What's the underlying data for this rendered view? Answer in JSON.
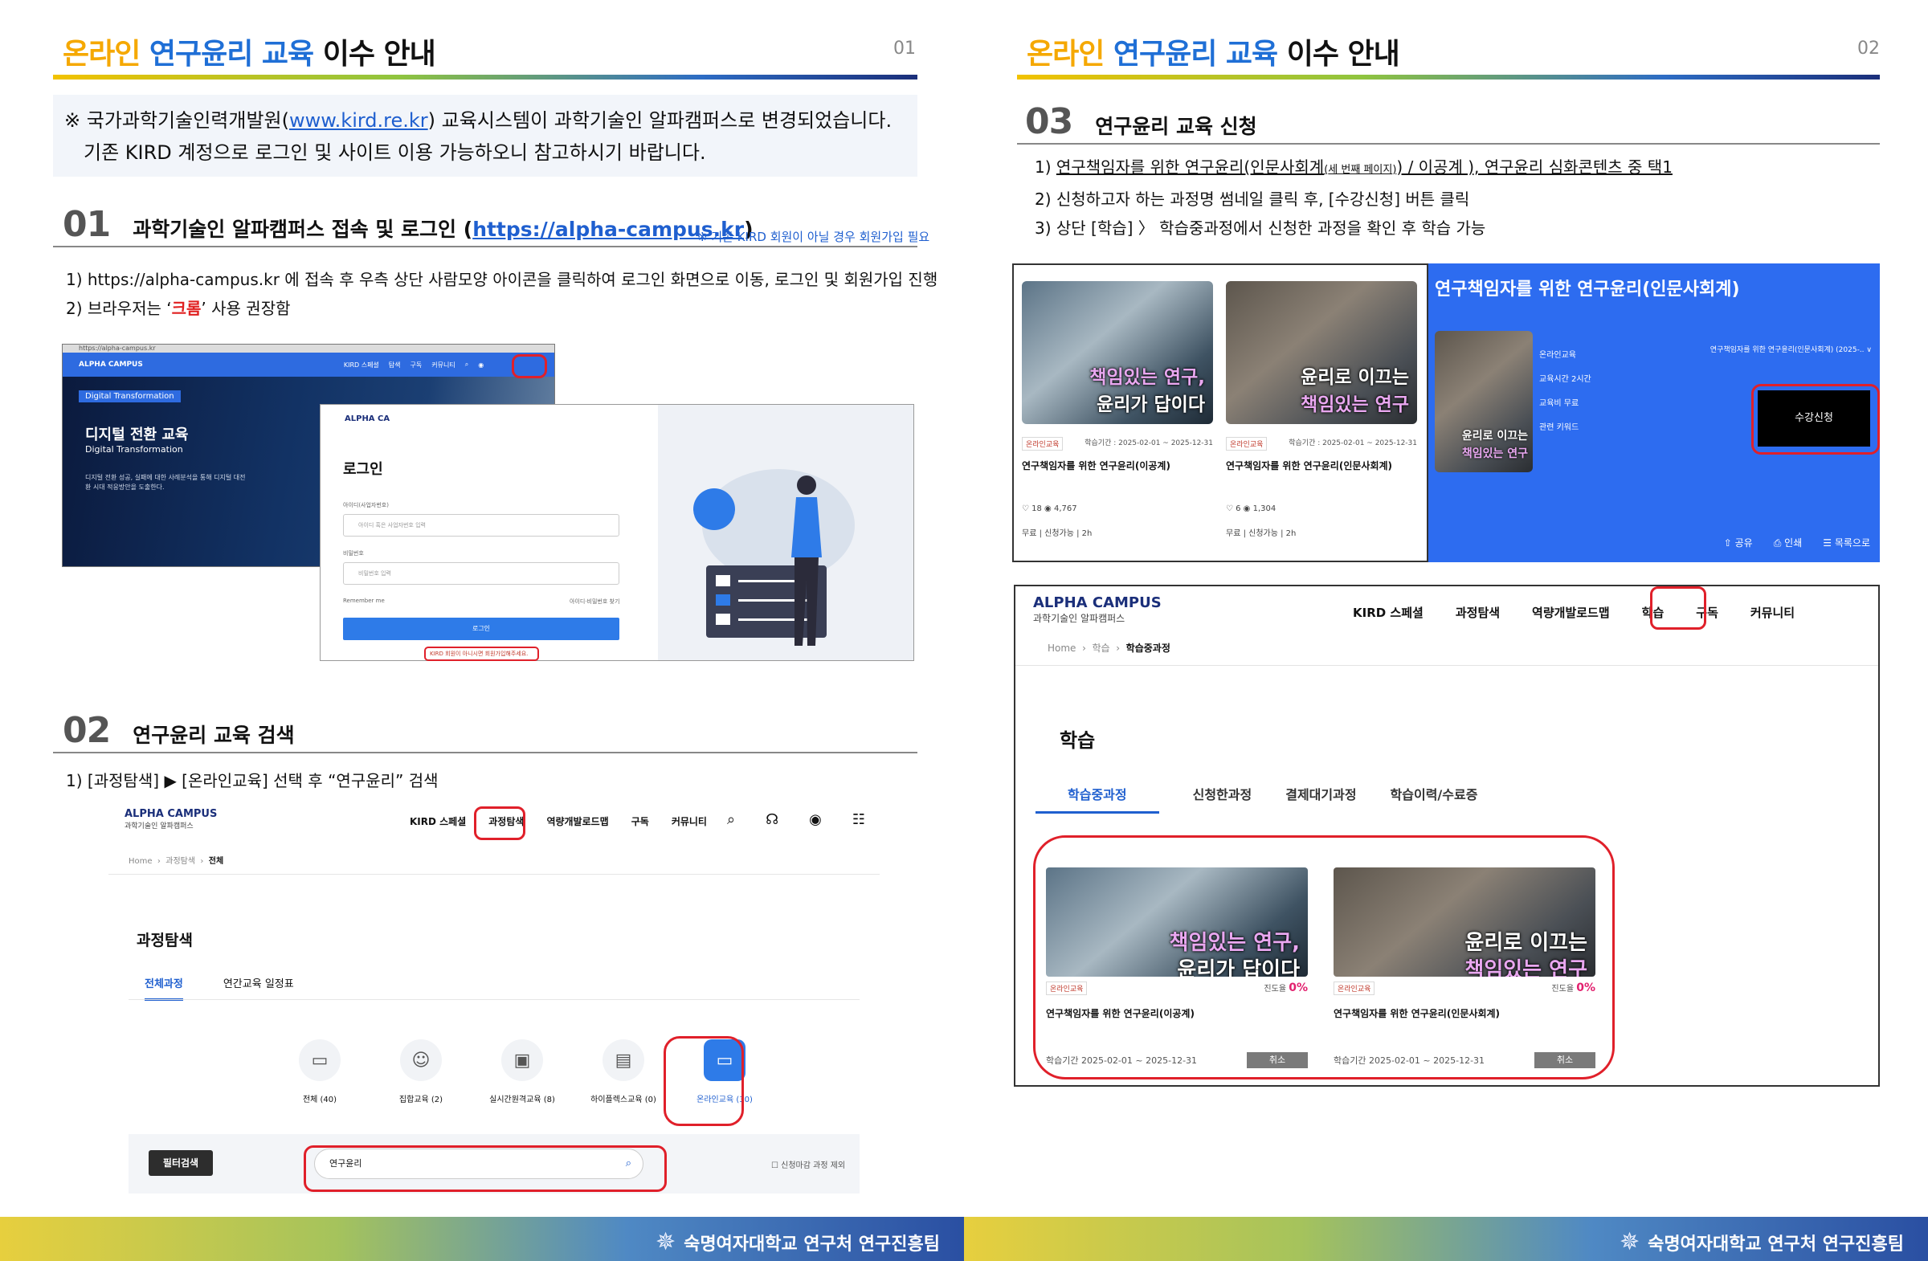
{
  "header": {
    "part_a": "온라인",
    "part_b": "연구윤리 교육",
    "part_c": "이수 안내"
  },
  "pages": [
    {
      "num": "01"
    },
    {
      "num": "02"
    }
  ],
  "notice": {
    "l1_pre": "※ 국가과학기술인력개발원(",
    "l1_link": "www.kird.re.kr",
    "l1_post": ") 교육시스템이 과학기술인 알파캠퍼스로 변경되었습니다.",
    "l2": "기존 KIRD 계정으로 로그인 및 사이트 이용 가능하오니 참고하시기 바랍니다."
  },
  "sec01": {
    "num": "01",
    "title_pre": "과학기술인 알파캠퍼스 접속 및 로그인 (",
    "title_link": "https://alpha-campus.kr",
    "title_post": ")",
    "sidenote": "※ 기존 KIRD 회원이 아닐 경우 회원가입 필요",
    "step1": "1)  https://alpha-campus.kr 에 접속 후 우측 상단 사람모양 아이콘을 클릭하여 로그인 화면으로 이동, 로그인 및 회원가입 진행",
    "step2_pre": "2)  브라우저는 ‘",
    "step2_em": "크롬",
    "step2_post": "’ 사용 권장함"
  },
  "shot1": {
    "url": "https://alpha-campus.kr",
    "logo": "ALPHA CAMPUS",
    "menu": [
      "KIRD 스페셜",
      "탐색",
      "구독",
      "커뮤니티"
    ],
    "tag": "Digital Transformation",
    "title": "디지털 전환 교육",
    "subtitle": "Digital Transformation",
    "desc": "디지털 전환 성공, 실패에 대한 사례분석을 통해 디지털 대전환 시대 적응방안을 도출한다.",
    "login_logo": "ALPHA CA",
    "login_title": "로그인",
    "id_label": "아이디(사업자번호)",
    "id_placeholder": "아이디 혹은 사업자번호 입력",
    "pw_label": "비밀번호",
    "pw_placeholder": "비밀번호 입력",
    "remember": "Remember me",
    "find": "아이디·비밀번호 찾기",
    "login_btn": "로그인",
    "signup": "KIRD 회원이 아니시면 회원가입해주세요."
  },
  "sec02": {
    "num": "02",
    "title": "연구윤리 교육 검색",
    "step1": "1)  [과정탐색] ▶ [온라인교육] 선택 후 “연구윤리” 검색"
  },
  "shot2": {
    "brand": "ALPHA CAMPUS",
    "brand_sub": "과학기술인 알파캠퍼스",
    "menu": [
      "KIRD 스페셜",
      "과정탐색",
      "역량개발로드맵",
      "구독",
      "커뮤니티"
    ],
    "bc_home": "Home",
    "bc_mid": "과정탐색",
    "bc_cur": "전체",
    "title": "과정탐색",
    "tab_on": "전체과정",
    "tab_off": "연간교육 일정표",
    "cats": [
      "전체 (40)",
      "집합교육 (2)",
      "실시간원격교육 (8)",
      "하이플렉스교육 (0)",
      "온라인교육 (30)"
    ],
    "filter_btn": "필터검색",
    "search_value": "연구윤리",
    "checkbox": "신청마감 과정 제외"
  },
  "sec03": {
    "num": "03",
    "title": "연구윤리 교육 신청",
    "step1_pre": "1)  ",
    "step1_u1": "연구책임자를 위한 연구윤리(인문사회계",
    "step1_small": "세 번째 페이지",
    "step1_u2": ") / 이공계 ), 연구윤리 심화콘텐츠 중 택1",
    "step2": "2)  신청하고자 하는 과정명 썸네일 클릭 후, [수강신청] 버튼 클릭",
    "step3": "3)  상단 [학습] 〉 학습중과정에서 신청한 과정을 확인 후 학습 가능"
  },
  "cards": [
    {
      "l1": "책임있는 연구,",
      "l2": "윤리가 답이다",
      "tag": "온라인교육",
      "period": "학습기간 : 2025-02-01 ~ 2025-12-31",
      "title": "연구책임자를 위한 연구윤리(이공계)",
      "stats": "♡ 18   ◉ 4,767",
      "price": "무료 | 신청가능 | 2h"
    },
    {
      "l1": "윤리로 이끄는",
      "l2": "책임있는 연구",
      "tag": "온라인교육",
      "period": "학습기간 : 2025-02-01 ~ 2025-12-31",
      "title": "연구책임자를 위한 연구윤리(인문사회계)",
      "stats": "♡ 6   ◉ 1,304",
      "price": "무료 | 신청가능 | 2h"
    }
  ],
  "blue": {
    "title": "연구책임자를 위한 연구윤리(인문사회계)",
    "thumb_l1": "윤리로 이끄는",
    "thumb_l2": "책임있는 연구",
    "info": [
      "온라인교육",
      "교육시간   2시간",
      "교육비   무료",
      "관련 키워드"
    ],
    "select": "연구책임자를 위한 연구윤리(인문사회계) (2025-.. ∨",
    "apply": "수강신청",
    "bottom": [
      "공유",
      "인쇄",
      "목록으로"
    ]
  },
  "learn": {
    "brand": "ALPHA CAMPUS",
    "brand_sub": "과학기술인 알파캠퍼스",
    "menu": [
      "KIRD 스페셜",
      "과정탐색",
      "역량개발로드맵",
      "학습",
      "구독",
      "커뮤니티"
    ],
    "bc_home": "Home",
    "bc_mid": "학습",
    "bc_cur": "학습중과정",
    "title": "학습",
    "tabs": [
      "학습중과정",
      "신청한과정",
      "결제대기과정",
      "학습이력/수료증"
    ],
    "cards": [
      {
        "l1": "책임있는 연구,",
        "l2": "윤리가 답이다",
        "tag": "온라인교육",
        "pct_label": "진도율",
        "pct": "0%",
        "title": "연구책임자를 위한 연구윤리(이공계)",
        "period": "학습기간   2025-02-01 ~ 2025-12-31",
        "cancel": "취소"
      },
      {
        "l1": "윤리로 이끄는",
        "l2": "책임있는 연구",
        "tag": "온라인교육",
        "pct_label": "진도율",
        "pct": "0%",
        "title": "연구책임자를 위한 연구윤리(인문사회계)",
        "period": "학습기간   2025-02-01 ~ 2025-12-31",
        "cancel": "취소"
      }
    ]
  },
  "footer": {
    "text": "숙명여자대학교 연구처 연구진흥팀"
  }
}
